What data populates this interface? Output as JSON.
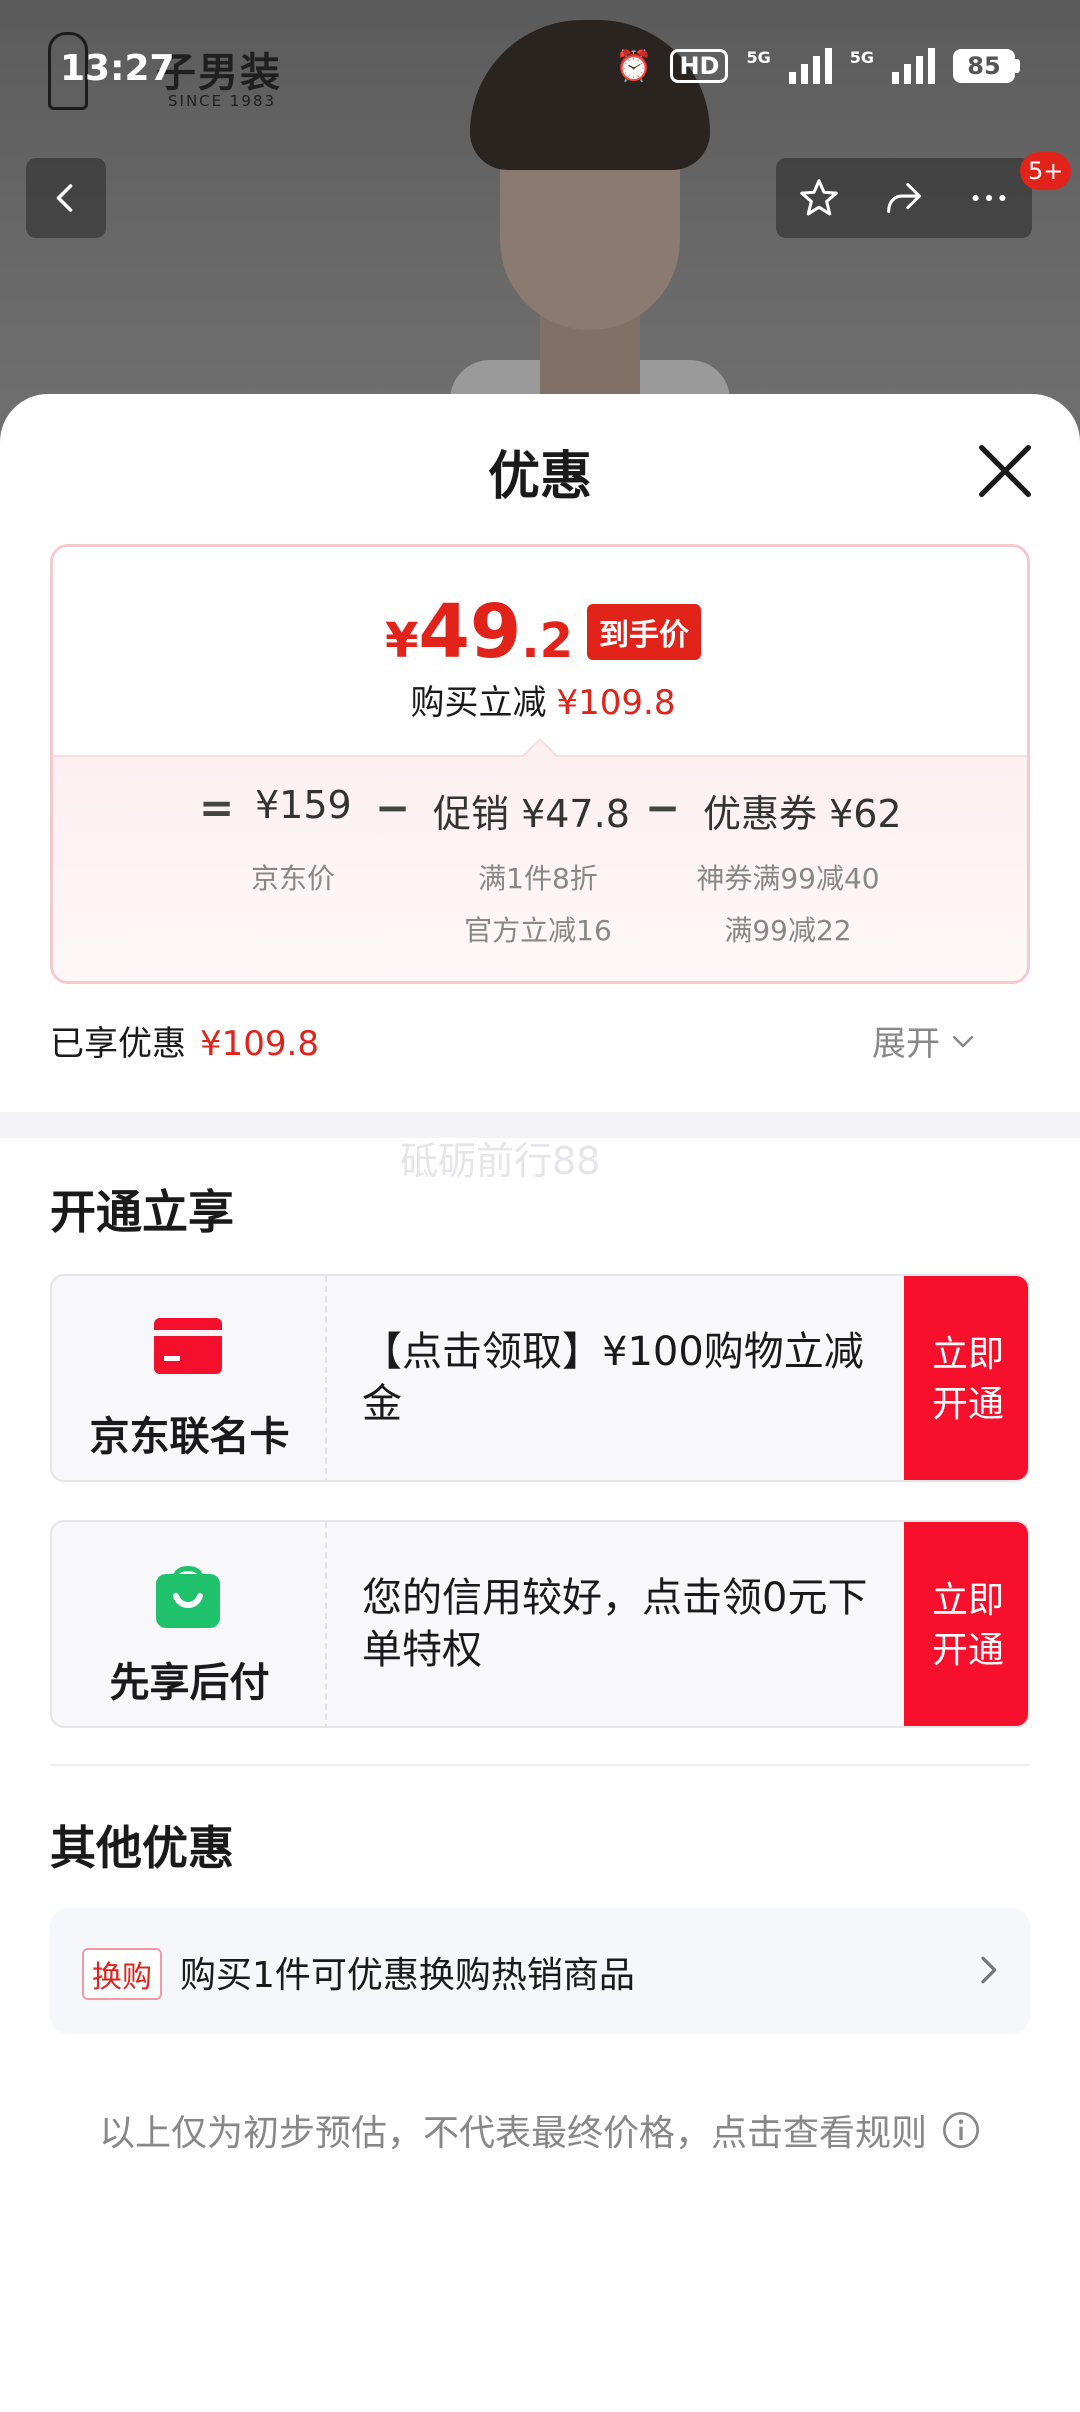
{
  "status_bar": {
    "time": "13:27",
    "hd_label": "HD",
    "signal_label_1": "5G",
    "signal_label_2": "5G",
    "battery": "85"
  },
  "header": {
    "brand_name": "子男装",
    "brand_since": "SINCE 1983",
    "message_badge": "5+"
  },
  "sheet": {
    "title": "优惠",
    "final_price": {
      "currency": "¥",
      "integer": "49",
      "decimal": ".2",
      "tag": "到手价"
    },
    "reduce": {
      "label": "购买立减",
      "amount": "¥109.8"
    },
    "formula": {
      "eq": "=",
      "jd_price": "¥159",
      "minus1": "−",
      "promo": "促销 ¥47.8",
      "minus2": "−",
      "coupon": "优惠券 ¥62",
      "jd_price_label": "京东价",
      "promo_sub_1": "满1件8折",
      "promo_sub_2": "官方立减16",
      "coupon_sub_1": "神券满99减40",
      "coupon_sub_2": "满99减22"
    },
    "enjoyed": {
      "label": "已享优惠",
      "amount": "¥109.8",
      "expand_label": "展开"
    },
    "watermark": "砥砺前行88",
    "open_section": {
      "title": "开通立享",
      "offers": [
        {
          "label": "京东联名卡",
          "desc": "【点击领取】¥100购物立减金",
          "button": "立即开通",
          "icon": "card-icon"
        },
        {
          "label": "先享后付",
          "desc": "您的信用较好，点击领0元下单特权",
          "button": "立即开通",
          "icon": "shopping-bag-icon"
        }
      ]
    },
    "other_section": {
      "title": "其他优惠",
      "swap_tag": "换购",
      "swap_text": "购买1件可优惠换购热销商品"
    },
    "disclaimer": "以上仅为初步预估，不代表最终价格，点击查看规则"
  },
  "colors": {
    "accent_red": "#e2231a",
    "button_red": "#f6102c",
    "green": "#1fc26b"
  }
}
